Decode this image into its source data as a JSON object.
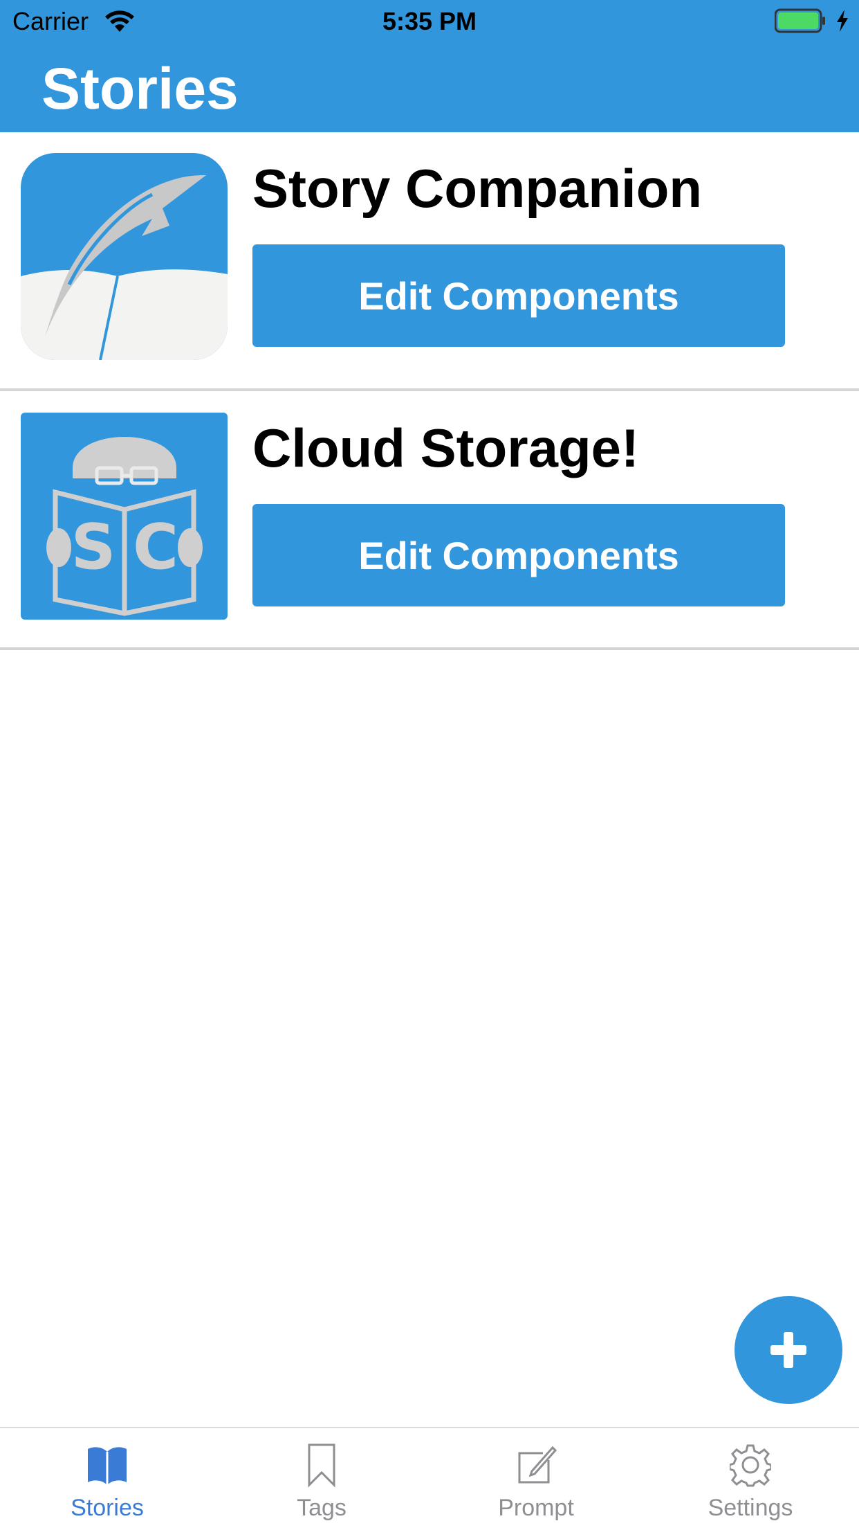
{
  "status_bar": {
    "carrier": "Carrier",
    "time": "5:35 PM"
  },
  "header": {
    "title": "Stories"
  },
  "stories": [
    {
      "name": "Story Companion",
      "button_label": "Edit Components",
      "icon": "feather-book-icon"
    },
    {
      "name": "Cloud Storage!",
      "button_label": "Edit Components",
      "icon": "sc-reader-icon"
    }
  ],
  "fab": {
    "icon": "plus-icon"
  },
  "tabs": [
    {
      "label": "Stories",
      "icon": "book-icon",
      "active": true
    },
    {
      "label": "Tags",
      "icon": "bookmark-icon",
      "active": false
    },
    {
      "label": "Prompt",
      "icon": "compose-icon",
      "active": false
    },
    {
      "label": "Settings",
      "icon": "gear-icon",
      "active": false
    }
  ],
  "colors": {
    "accent": "#3296DC",
    "tab_active": "#3A7BD5",
    "tab_inactive": "#8e8e93",
    "icon_gray": "#cfcfcf"
  }
}
